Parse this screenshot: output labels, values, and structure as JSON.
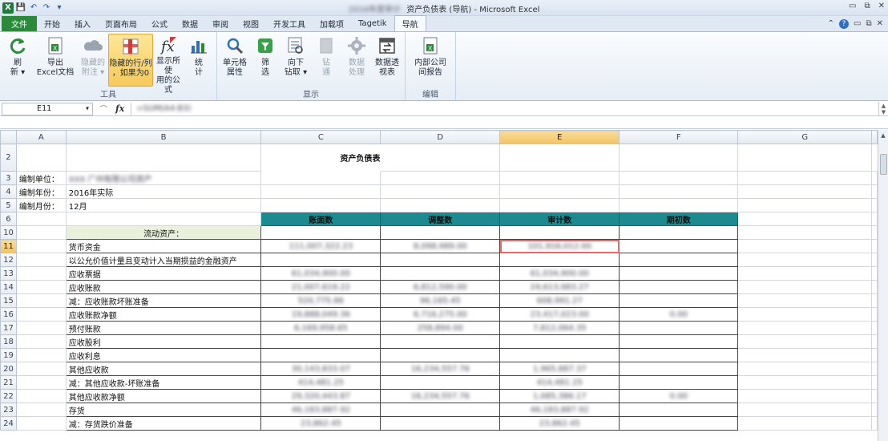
{
  "window": {
    "title": "资产负债表 (导航) - Microsoft Excel",
    "title_prefix_blur": "2016年度审计"
  },
  "ribbon_tabs": [
    "文件",
    "开始",
    "插入",
    "页面布局",
    "公式",
    "数据",
    "审阅",
    "视图",
    "开发工具",
    "加载项",
    "Tagetik",
    "导航"
  ],
  "active_tab": "导航",
  "ribbon": {
    "groups": [
      {
        "label": "工具",
        "buttons": [
          {
            "label": "刷\n新 ▾",
            "icon": "refresh-icon",
            "disabled": false,
            "highlighted": false
          },
          {
            "label": "导出\nExcel文档",
            "icon": "excel-export-icon",
            "disabled": false,
            "highlighted": false
          },
          {
            "label": "隐藏的\n附注 ▾",
            "icon": "cloud-icon",
            "disabled": true,
            "highlighted": false
          },
          {
            "label": "隐藏的行/列\n，如果为0",
            "icon": "hide-rows-icon",
            "disabled": false,
            "highlighted": true
          },
          {
            "label": "显示所使\n用的公式",
            "icon": "formula-icon",
            "disabled": false,
            "highlighted": false
          },
          {
            "label": "统\n计",
            "icon": "bar-chart-icon",
            "disabled": false,
            "highlighted": false
          }
        ]
      },
      {
        "label": "显示",
        "buttons": [
          {
            "label": "单元格\n属性",
            "icon": "magnifier-icon",
            "disabled": false,
            "highlighted": false
          },
          {
            "label": "筛\n选",
            "icon": "filter-icon",
            "disabled": false,
            "highlighted": false
          },
          {
            "label": "向下\n钻取 ▾",
            "icon": "drill-down-icon",
            "disabled": false,
            "highlighted": false
          },
          {
            "label": "钻\n通",
            "icon": "drill-through-icon",
            "disabled": true,
            "highlighted": false
          },
          {
            "label": "数据\n处理",
            "icon": "gear-icon",
            "disabled": true,
            "highlighted": false
          },
          {
            "label": "数据透\n视表",
            "icon": "pivot-icon",
            "disabled": false,
            "highlighted": false
          }
        ]
      },
      {
        "label": "编辑",
        "buttons": [
          {
            "label": "内部公司\n间报告",
            "icon": "intercompany-icon",
            "disabled": false,
            "highlighted": false
          }
        ]
      }
    ]
  },
  "formula_bar": {
    "cell_ref": "E11",
    "formula_blur": "=SUM(A4:B3)"
  },
  "sheet": {
    "columns": [
      "A",
      "B",
      "C",
      "D",
      "E",
      "F",
      "G"
    ],
    "selected_col": "E",
    "title": "资产负债表",
    "unit_label": "编制单位：",
    "unit_value": "XXX 广州有限公司资产",
    "year_label": "编制年份：",
    "year_value": "2016年实际",
    "month_label": "编制月份：",
    "month_value": "12月",
    "headers": [
      "账面数",
      "调整数",
      "审计数",
      "期初数"
    ],
    "section_title": "流动资产：",
    "rows": [
      {
        "n": "11",
        "label": "货币资金",
        "c": "111,007,322.23",
        "d": "8,098,989.00",
        "e": "101,916,012.00",
        "f": ""
      },
      {
        "n": "12",
        "label": "以公允价值计量且变动计入当期损益的金融资产",
        "c": "",
        "d": "",
        "e": "",
        "f": ""
      },
      {
        "n": "13",
        "label": "应收票据",
        "c": "61,034,900.00",
        "d": "",
        "e": "61,034,900.00",
        "f": ""
      },
      {
        "n": "14",
        "label": "应收账款",
        "c": "21,007,619.22",
        "d": "6,812,590.00",
        "e": "24,613,983.27",
        "f": ""
      },
      {
        "n": "15",
        "label": "减：应收账款坏账准备",
        "c": "520,775.86",
        "d": "96,165.45",
        "e": "608,991.27",
        "f": ""
      },
      {
        "n": "16",
        "label": "应收账款净额",
        "c": "19,888,049.36",
        "d": "6,716,275.00",
        "e": "23,417,023.00",
        "f": "0.00"
      },
      {
        "n": "17",
        "label": "预付账款",
        "c": "6,169,958.65",
        "d": "258,894.00",
        "e": "7,812,064.35",
        "f": ""
      },
      {
        "n": "18",
        "label": "应收股利",
        "c": "",
        "d": "",
        "e": "",
        "f": ""
      },
      {
        "n": "19",
        "label": "应收利息",
        "c": "",
        "d": "",
        "e": "",
        "f": ""
      },
      {
        "n": "20",
        "label": "其他应收款",
        "c": "30,143,833.07",
        "d": "16,234,557.76",
        "e": "1,965,887.37",
        "f": ""
      },
      {
        "n": "21",
        "label": "减：其他应收款-坏账准备",
        "c": "414,481.25",
        "d": "",
        "e": "414,481.25",
        "f": ""
      },
      {
        "n": "22",
        "label": "其他应收款净额",
        "c": "29,320,443.87",
        "d": "16,234,557.76",
        "e": "1,085,386.17",
        "f": "0.00"
      },
      {
        "n": "23",
        "label": "存货",
        "c": "46,183,887.92",
        "d": "",
        "e": "46,183,887.92",
        "f": ""
      },
      {
        "n": "24",
        "label": "减：存货跌价准备",
        "c": "23,862.45",
        "d": "",
        "e": "23,862.45",
        "f": ""
      }
    ],
    "selected_row": "11"
  },
  "colors": {
    "accent_green": "#2a8a3a",
    "header_teal": "#1c8a8f",
    "section_fill": "#e9f1dd",
    "selection": "#e46a6a"
  }
}
